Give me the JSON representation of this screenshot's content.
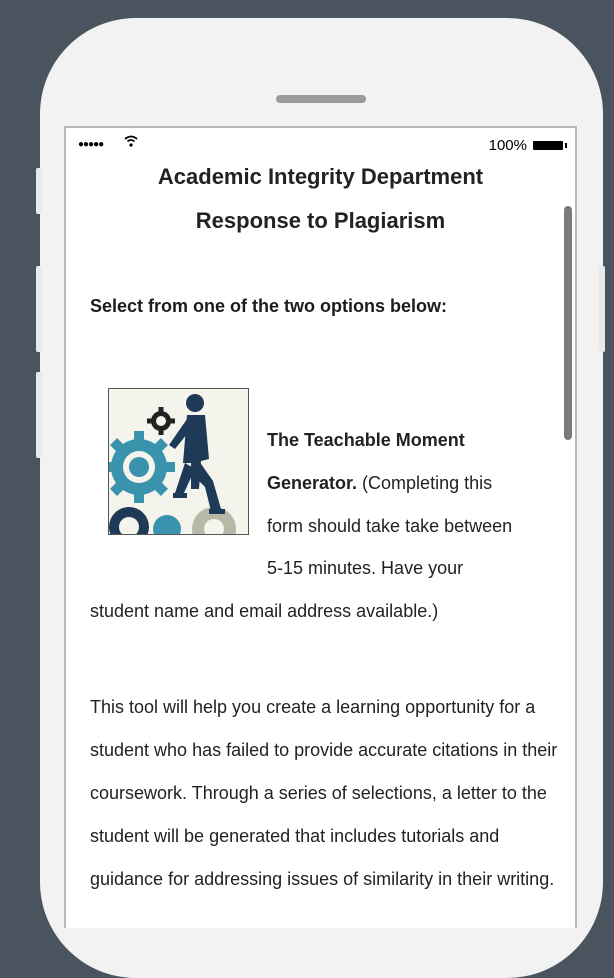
{
  "status": {
    "signal": "●●●●●",
    "battery_label": "100%"
  },
  "header": {
    "title_line1": "Academic Integrity Department",
    "title_line2": "Response to Plagiarism"
  },
  "prompt": "Select from one of the two options below:",
  "option": {
    "image_icon": "gears-climbing-figure",
    "name_line1": "The Teachable Moment",
    "name_line2_bold": "Generator.",
    "name_line2_rest": " (Completing this",
    "line3": "form should take take between",
    "line4": "5-15 minutes. Have your",
    "line5": "student name and email address available.)"
  },
  "description": "This tool will help you create a learning opportunity for a student who has failed to provide accurate citations in their coursework. Through a series of selections, a letter to the student will be generated that includes tutorials and guidance for addressing issues of similarity in their writing."
}
